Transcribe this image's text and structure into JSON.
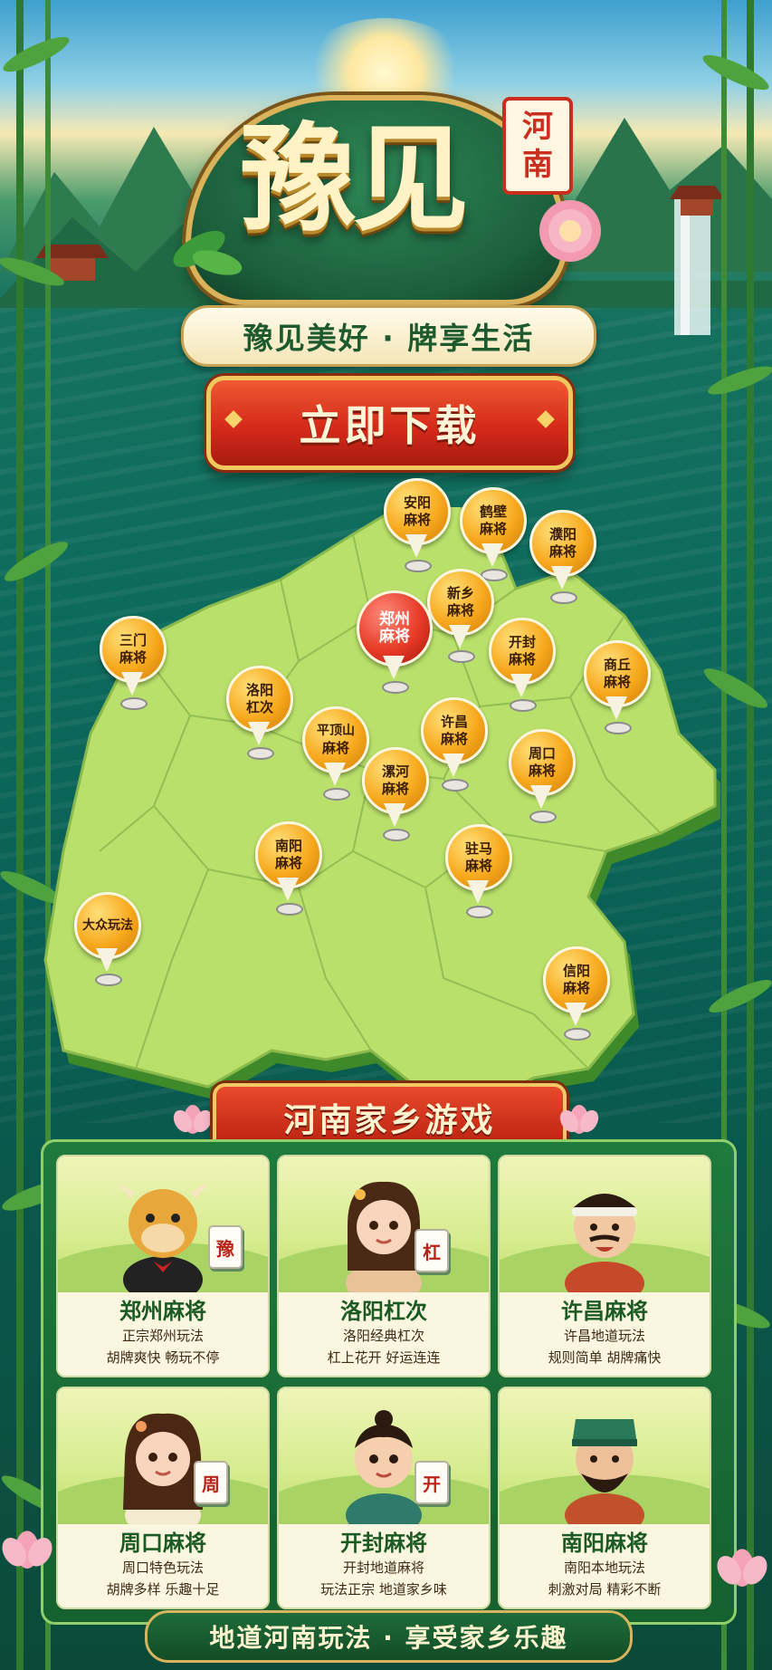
{
  "logo": {
    "title": "豫见",
    "seal_chars": [
      "河",
      "南"
    ]
  },
  "slogan": "豫见美好 · 牌享生活",
  "download_button": "立即下载",
  "map_pins": [
    {
      "l1": "安阳",
      "l2": "麻将",
      "style": "orange"
    },
    {
      "l1": "鹤壁",
      "l2": "麻将",
      "style": "orange"
    },
    {
      "l1": "濮阳",
      "l2": "麻将",
      "style": "orange"
    },
    {
      "l1": "新乡",
      "l2": "麻将",
      "style": "orange"
    },
    {
      "l1": "郑州",
      "l2": "麻将",
      "style": "red"
    },
    {
      "l1": "三门",
      "l2": "麻将",
      "style": "orange"
    },
    {
      "l1": "开封",
      "l2": "麻将",
      "style": "orange"
    },
    {
      "l1": "商丘",
      "l2": "麻将",
      "style": "orange"
    },
    {
      "l1": "洛阳",
      "l2": "杠次",
      "style": "orange"
    },
    {
      "l1": "平顶山",
      "l2": "麻将",
      "style": "orange"
    },
    {
      "l1": "许昌",
      "l2": "麻将",
      "style": "orange"
    },
    {
      "l1": "漯河",
      "l2": "麻将",
      "style": "orange"
    },
    {
      "l1": "周口",
      "l2": "麻将",
      "style": "orange"
    },
    {
      "l1": "南阳",
      "l2": "麻将",
      "style": "orange"
    },
    {
      "l1": "驻马",
      "l2": "麻将",
      "style": "orange"
    },
    {
      "l1": "大众玩法",
      "l2": "",
      "style": "orange"
    },
    {
      "l1": "信阳",
      "l2": "麻将",
      "style": "orange"
    }
  ],
  "section_title": "河南家乡游戏",
  "games": [
    {
      "title": "郑州麻将",
      "line1": "正宗郑州玩法",
      "line2": "胡牌爽快 畅玩不停",
      "tile": "豫",
      "character": "bull-mascot"
    },
    {
      "title": "洛阳杠次",
      "line1": "洛阳经典杠次",
      "line2": "杠上花开 好运连连",
      "tile": "杠",
      "character": "girl"
    },
    {
      "title": "许昌麻将",
      "line1": "许昌地道玩法",
      "line2": "规则简单 胡牌痛快",
      "tile": "",
      "character": "uncle-headband"
    },
    {
      "title": "周口麻将",
      "line1": "周口特色玩法",
      "line2": "胡牌多样 乐趣十足",
      "tile": "周",
      "character": "woman"
    },
    {
      "title": "开封麻将",
      "line1": "开封地道麻将",
      "line2": "玩法正宗 地道家乡味",
      "tile": "开",
      "character": "boy"
    },
    {
      "title": "南阳麻将",
      "line1": "南阳本地玩法",
      "line2": "刺激对局 精彩不断",
      "tile": "",
      "character": "bearded-man"
    }
  ],
  "footer": "地道河南玩法 · 享受家乡乐趣",
  "colors": {
    "accent_red": "#d52a1a",
    "gold": "#f0c85e",
    "map_green": "#b7df66",
    "pin_orange": "#f7a81c",
    "title_green": "#1c5a23"
  }
}
